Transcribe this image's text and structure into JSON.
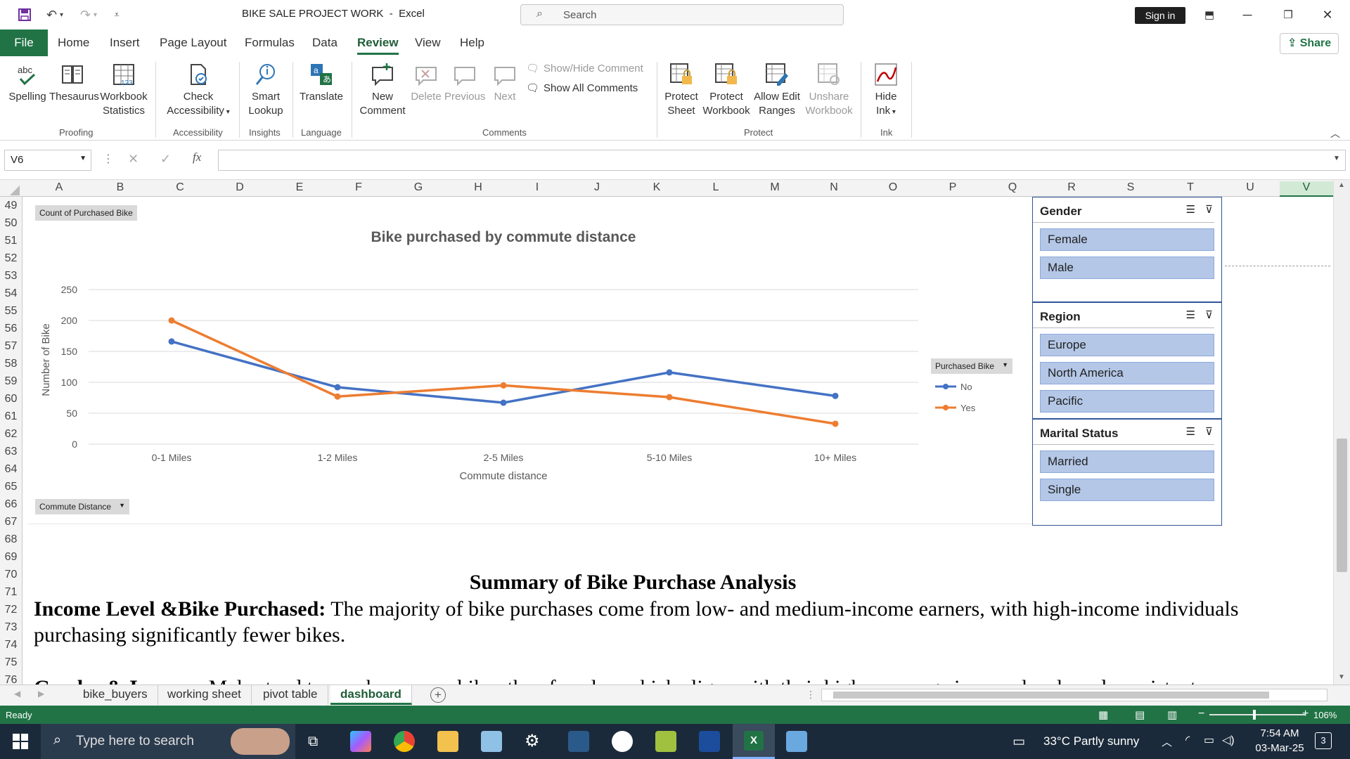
{
  "window": {
    "doc_title": "BIKE SALE PROJECT WORK  -  Excel",
    "search_placeholder": "Search",
    "sign_in": "Sign in"
  },
  "menu": {
    "file": "File",
    "tabs": [
      "Home",
      "Insert",
      "Page Layout",
      "Formulas",
      "Data",
      "Review",
      "View",
      "Help"
    ],
    "active_tab": "Review",
    "share": "Share"
  },
  "ribbon": {
    "proofing": {
      "label": "Proofing",
      "spelling": "Spelling",
      "thesaurus": "Thesaurus",
      "workbook_stats_1": "Workbook",
      "workbook_stats_2": "Statistics",
      "spelling_icon_text": "abc",
      "stats_icon_text": "123"
    },
    "accessibility": {
      "label": "Accessibility",
      "check_1": "Check",
      "check_2": "Accessibility"
    },
    "insights": {
      "label": "Insights",
      "smart_1": "Smart",
      "smart_2": "Lookup"
    },
    "language": {
      "label": "Language",
      "translate": "Translate"
    },
    "comments": {
      "label": "Comments",
      "new_1": "New",
      "new_2": "Comment",
      "delete": "Delete",
      "previous": "Previous",
      "next": "Next",
      "show_hide": "Show/Hide Comment",
      "show_all": "Show All Comments"
    },
    "protect": {
      "label": "Protect",
      "sheet_1": "Protect",
      "sheet_2": "Sheet",
      "workbook_1": "Protect",
      "workbook_2": "Workbook",
      "ranges_1": "Allow Edit",
      "ranges_2": "Ranges",
      "unshare_1": "Unshare",
      "unshare_2": "Workbook"
    },
    "ink": {
      "label": "Ink",
      "hide_1": "Hide",
      "hide_2": "Ink"
    }
  },
  "formula_bar": {
    "name_box": "V6",
    "formula": ""
  },
  "columns": [
    "A",
    "B",
    "C",
    "D",
    "E",
    "F",
    "G",
    "H",
    "I",
    "J",
    "K",
    "L",
    "M",
    "N",
    "O",
    "P",
    "Q",
    "R",
    "S",
    "T",
    "U",
    "V"
  ],
  "selected_column": "V",
  "rows": [
    "49",
    "50",
    "51",
    "52",
    "53",
    "54",
    "55",
    "56",
    "57",
    "58",
    "59",
    "60",
    "61",
    "62",
    "63",
    "64",
    "65",
    "66",
    "67",
    "68",
    "69",
    "70",
    "71",
    "72",
    "73",
    "74",
    "75",
    "76"
  ],
  "pivot": {
    "values_button": "Count  of Purchased Bike",
    "axis_button": "Commute Distance",
    "legend_button": "Purchased  Bike"
  },
  "chart_data": {
    "type": "line",
    "title": "Bike purchased by commute distance",
    "xlabel": "Commute distance",
    "ylabel": "Number of Bike",
    "categories": [
      "0-1 Miles",
      "1-2 Miles",
      "2-5 Miles",
      "5-10 Miles",
      "10+ Miles"
    ],
    "series": [
      {
        "name": "No",
        "values": [
          166,
          92,
          67,
          116,
          78
        ],
        "color": "#4472c4"
      },
      {
        "name": "Yes",
        "values": [
          200,
          77,
          95,
          76,
          33
        ],
        "color": "#ed7d31"
      }
    ],
    "yticks": [
      "0",
      "50",
      "100",
      "150",
      "200",
      "250"
    ],
    "ylim": [
      0,
      250
    ],
    "grid": true,
    "legend_position": "right"
  },
  "slicers": [
    {
      "title": "Gender",
      "items": [
        "Female",
        "Male"
      ]
    },
    {
      "title": "Region",
      "items": [
        "Europe",
        "North America",
        "Pacific"
      ]
    },
    {
      "title": "Marital Status",
      "items": [
        "Married",
        "Single"
      ]
    }
  ],
  "summary": {
    "title": "Summary of Bike Purchase Analysis",
    "p1_heading": "Income Level &Bike Purchased:",
    "p1_text": " The majority of bike purchases come from low- and medium-income earners, with high-income individuals purchasing significantly fewer bikes.",
    "p2_heading": "Gender & Income:",
    "p2_text": " Males tend to purchase more bikes than females, which aligns with their higher average income levels and consistent"
  },
  "sheet_tabs": [
    "bike_buyers",
    "working sheet",
    "pivot table",
    "dashboard"
  ],
  "active_sheet": "dashboard",
  "status": {
    "ready": "Ready",
    "zoom": "106%"
  },
  "taskbar": {
    "search_placeholder": "Type here to search",
    "weather": "33°C  Partly sunny",
    "time": "7:54 AM",
    "date": "03-Mar-25",
    "notifications": "3"
  },
  "colors": {
    "excel_green": "#217346",
    "slicer_fill": "#b4c7e7",
    "series_no": "#4472c4",
    "series_yes": "#ed7d31"
  }
}
